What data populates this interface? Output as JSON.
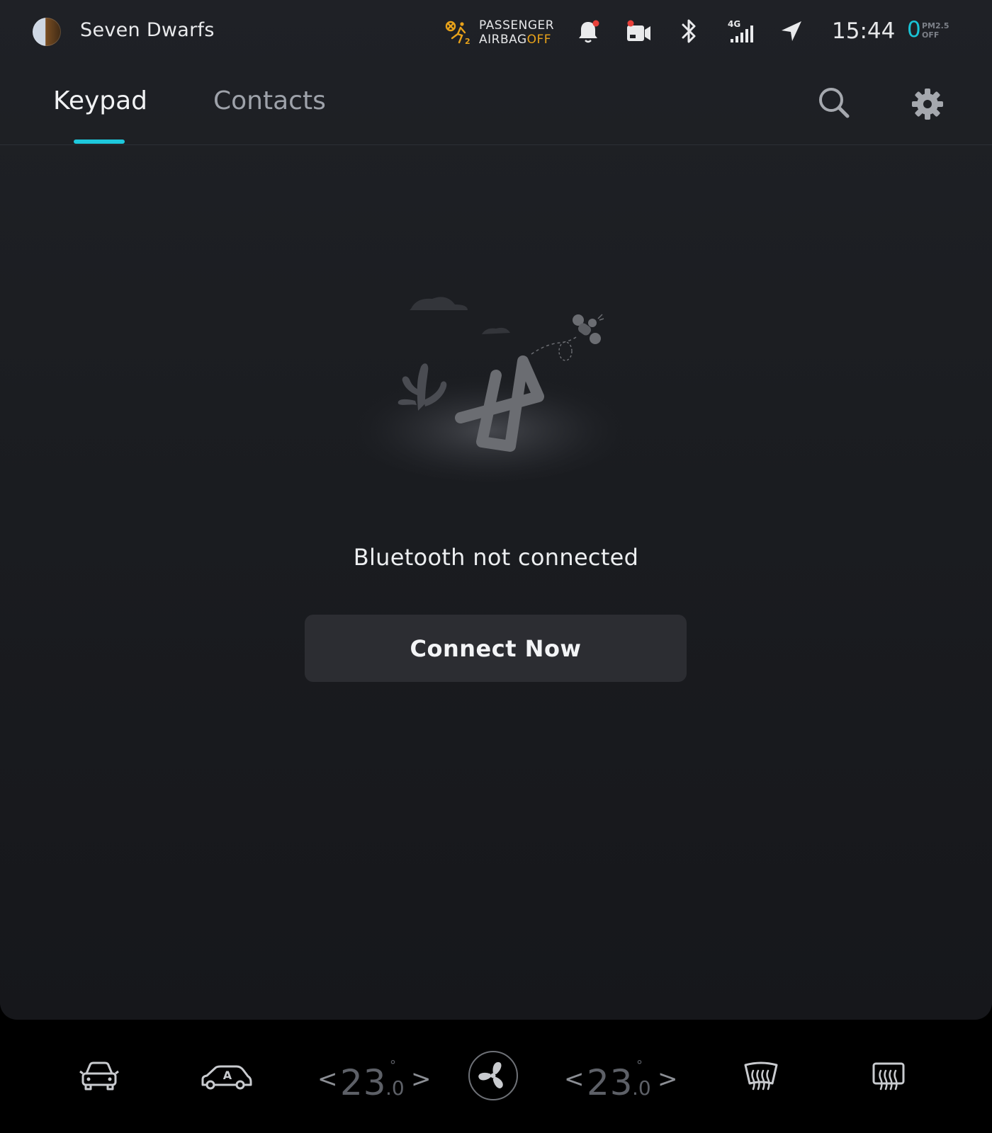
{
  "status_bar": {
    "profile_name": "Seven Dwarfs",
    "airbag": {
      "line1": "PASSENGER",
      "line2_prefix": "AIRBAG",
      "line2_state": "OFF"
    },
    "network": "4G",
    "time": "15:44",
    "pm25": {
      "value": "0",
      "label": "PM2.5",
      "state": "OFF"
    },
    "icons": [
      "avatar",
      "airbag-icon",
      "bell-icon",
      "dashcam-icon",
      "bluetooth-icon",
      "signal-icon",
      "navigation-icon"
    ],
    "colors": {
      "accent": "#1ec8dc",
      "warning": "#e8a21a",
      "notification_dot": "#e8403a"
    }
  },
  "tabs": [
    {
      "label": "Keypad",
      "active": true
    },
    {
      "label": "Contacts",
      "active": false
    }
  ],
  "toolbar": {
    "icons": [
      "search-icon",
      "settings-gear-icon"
    ]
  },
  "empty_state": {
    "message": "Bluetooth not connected",
    "button_label": "Connect Now"
  },
  "climate": {
    "left_temp": {
      "whole": "23",
      "degree": "°",
      "decimal": ".0"
    },
    "right_temp": {
      "whole": "23",
      "degree": "°",
      "decimal": ".0"
    },
    "left_arrow": "<",
    "right_arrow": ">",
    "icons": [
      "car-icon",
      "auto-car-icon",
      "fan-icon",
      "front-defrost-icon",
      "rear-defrost-icon"
    ],
    "auto_label": "A"
  }
}
